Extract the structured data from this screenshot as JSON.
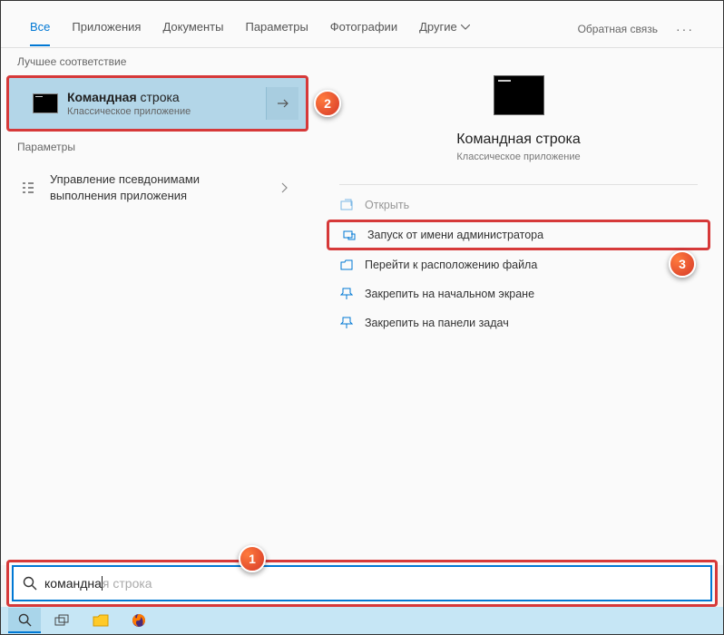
{
  "tabs": {
    "all": "Все",
    "apps": "Приложения",
    "docs": "Документы",
    "settings": "Параметры",
    "photos": "Фотографии",
    "more": "Другие"
  },
  "feedback": "Обратная связь",
  "sections": {
    "best_match": "Лучшее соответствие",
    "parameters": "Параметры"
  },
  "result": {
    "title_bold": "Командная",
    "title_rest": " строка",
    "subtitle": "Классическое приложение"
  },
  "params_item": {
    "text": "Управление псевдонимами выполнения приложения"
  },
  "preview": {
    "title": "Командная строка",
    "subtitle": "Классическое приложение"
  },
  "actions": {
    "open": "Открыть",
    "run_admin": "Запуск от имени администратора",
    "goto_file": "Перейти к расположению файла",
    "pin_start": "Закрепить на начальном экране",
    "pin_taskbar": "Закрепить на панели задач"
  },
  "search": {
    "typed": "командна",
    "ghost": "я строка"
  },
  "callouts": {
    "c1": "1",
    "c2": "2",
    "c3": "3"
  }
}
